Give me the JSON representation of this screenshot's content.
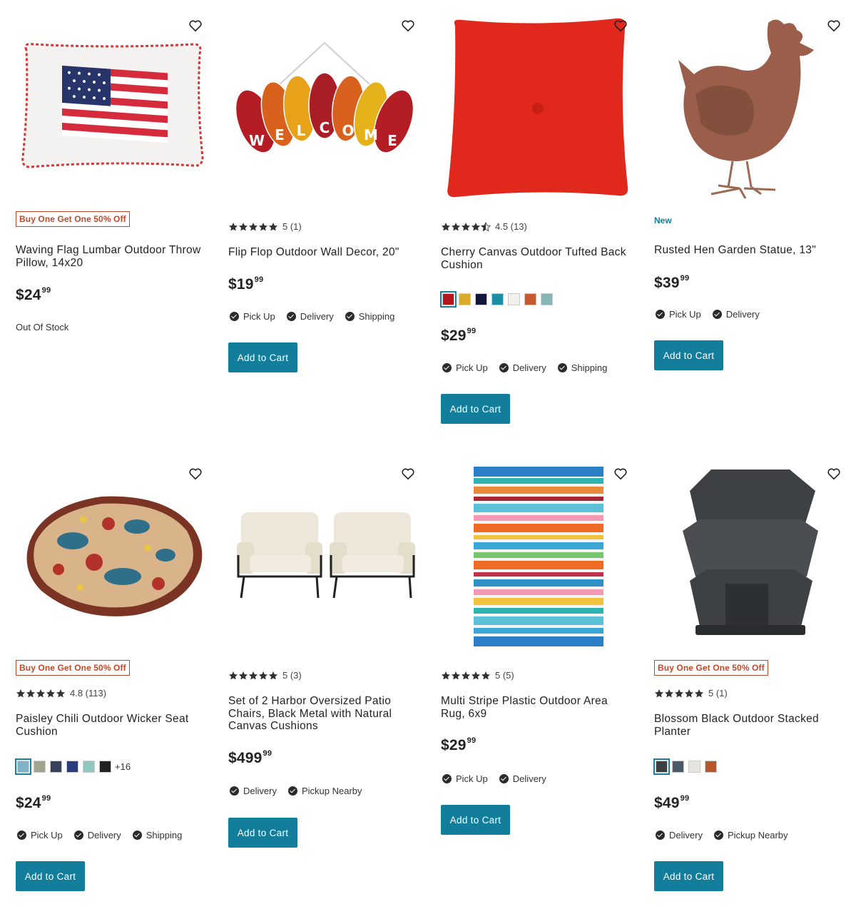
{
  "products": [
    {
      "badge": "Buy One Get One 50% Off",
      "title": "Waving Flag Lumbar Outdoor Throw Pillow, 14x20",
      "price_dollars": "$24",
      "price_cents": "99",
      "stock": "Out Of Stock"
    },
    {
      "rating_text": "5 (1)",
      "title": "Flip Flop Outdoor Wall Decor, 20\"",
      "price_dollars": "$19",
      "price_cents": "99",
      "fulfillment": [
        "Pick Up",
        "Delivery",
        "Shipping"
      ],
      "cart_label": "Add to Cart"
    },
    {
      "rating_text": "4.5 (13)",
      "title": "Cherry Canvas Outdoor Tufted Back Cushion",
      "swatches": [
        "#b3161c",
        "#d9aa2b",
        "#13183a",
        "#1d8ea8",
        "#f2f0ec",
        "#c65a2e",
        "#85b7b4"
      ],
      "price_dollars": "$29",
      "price_cents": "99",
      "fulfillment": [
        "Pick Up",
        "Delivery",
        "Shipping"
      ],
      "cart_label": "Add to Cart"
    },
    {
      "badge_new": "New",
      "title": "Rusted Hen Garden Statue, 13\"",
      "price_dollars": "$39",
      "price_cents": "99",
      "fulfillment": [
        "Pick Up",
        "Delivery"
      ],
      "cart_label": "Add to Cart"
    },
    {
      "badge": "Buy One Get One 50% Off",
      "rating_text": "4.8 (113)",
      "title": "Paisley Chili Outdoor Wicker Seat Cushion",
      "swatches": [
        "#7fb3c7",
        "#a2a58e",
        "#35415c",
        "#2a3d7a",
        "#8fc7c2",
        "#222222"
      ],
      "swatch_more": "+16",
      "price_dollars": "$24",
      "price_cents": "99",
      "fulfillment": [
        "Pick Up",
        "Delivery",
        "Shipping"
      ],
      "cart_label": "Add to Cart"
    },
    {
      "rating_text": "5 (3)",
      "title": "Set of 2 Harbor Oversized Patio Chairs, Black Metal with Natural Canvas Cushions",
      "price_dollars": "$499",
      "price_cents": "99",
      "fulfillment": [
        "Delivery",
        "Pickup Nearby"
      ],
      "cart_label": "Add to Cart"
    },
    {
      "rating_text": "5 (5)",
      "title": "Multi Stripe Plastic Outdoor Area Rug, 6x9",
      "price_dollars": "$29",
      "price_cents": "99",
      "fulfillment": [
        "Pick Up",
        "Delivery"
      ],
      "cart_label": "Add to Cart"
    },
    {
      "badge": "Buy One Get One 50% Off",
      "rating_text": "5 (1)",
      "title": "Blossom Black Outdoor Stacked Planter",
      "swatches": [
        "#3b3f42",
        "#4b5a6b",
        "#e6e4df",
        "#b8572c"
      ],
      "price_dollars": "$49",
      "price_cents": "99",
      "fulfillment": [
        "Delivery",
        "Pickup Nearby"
      ],
      "cart_label": "Add to Cart"
    }
  ],
  "icons": {
    "wishlist": "heart-outline-icon",
    "check": "check-circle-icon",
    "star": "star-icon"
  },
  "colors": {
    "accent": "#137e9c",
    "badge": "#c0482b",
    "new_badge": "#0d7f9e"
  }
}
